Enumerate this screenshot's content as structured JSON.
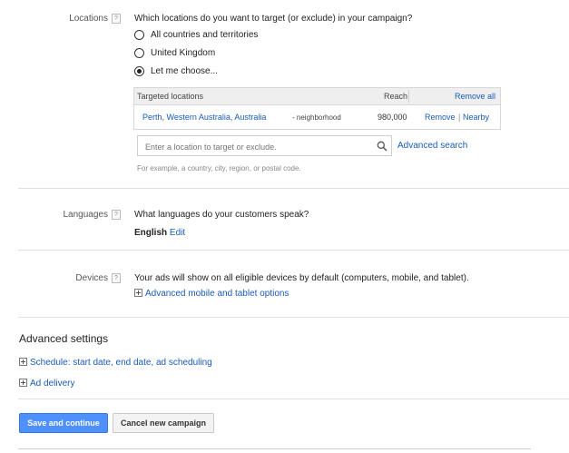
{
  "locations": {
    "label": "Locations",
    "help": "?",
    "question": "Which locations do you want to target (or exclude) in your campaign?",
    "options": [
      {
        "label": "All countries and territories",
        "checked": false
      },
      {
        "label": "United Kingdom",
        "checked": false
      },
      {
        "label": "Let me choose...",
        "checked": true
      }
    ],
    "table": {
      "headers": {
        "locations": "Targeted locations",
        "reach": "Reach",
        "remove_all": "Remove all"
      },
      "rows": [
        {
          "name": "Perth, Western Australia, Australia",
          "type": "- neighborhood",
          "reach": "980,000",
          "remove": "Remove",
          "sep": "|",
          "nearby": "Nearby"
        }
      ]
    },
    "search_placeholder": "Enter a location to target or exclude.",
    "advanced_search": "Advanced search",
    "hint": "For example, a country, city, region, or postal code."
  },
  "languages": {
    "label": "Languages",
    "help": "?",
    "question": "What languages do your customers speak?",
    "value": "English",
    "edit": "Edit"
  },
  "devices": {
    "label": "Devices",
    "help": "?",
    "text": "Your ads will show on all eligible devices by default (computers, mobile, and tablet).",
    "advanced_link": "Advanced mobile and tablet options"
  },
  "advanced": {
    "title": "Advanced settings",
    "schedule_link": "Schedule: start date, end date, ad scheduling",
    "delivery_link": "Ad delivery"
  },
  "buttons": {
    "save": "Save and continue",
    "cancel": "Cancel new campaign"
  },
  "colors": {
    "primary": "#4d90fe",
    "link": "#1a5bb8"
  }
}
